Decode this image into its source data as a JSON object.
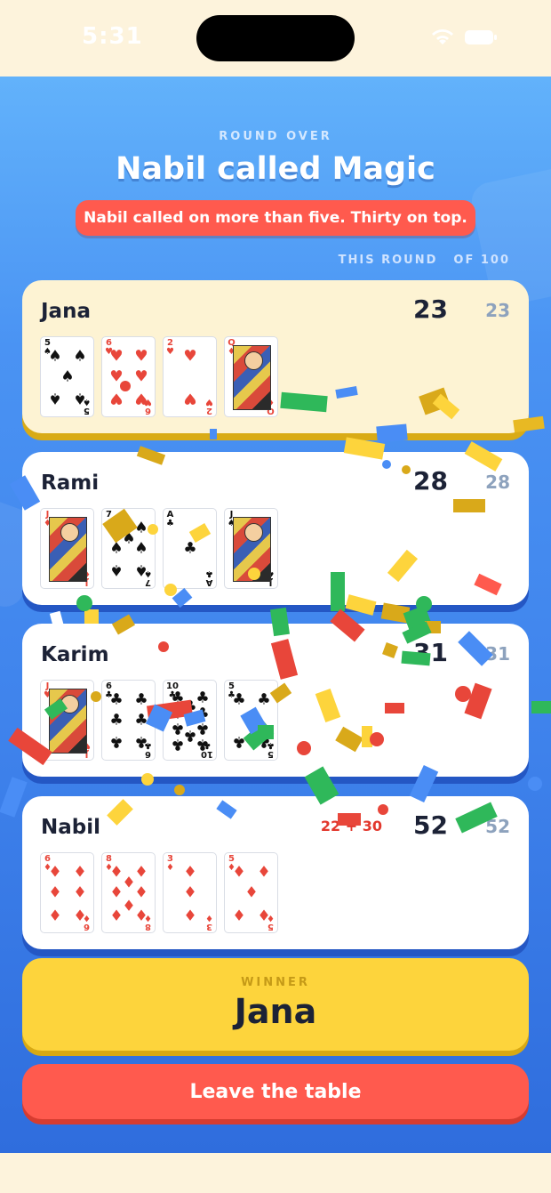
{
  "status_bar": {
    "time": "5:31"
  },
  "round": {
    "eyebrow": "ROUND OVER",
    "headline": "Nabil called Magic",
    "subtitle": "Nabil called on more than five. Thirty on top.",
    "col_round": "THIS ROUND",
    "col_total": "OF 100"
  },
  "players": [
    {
      "name": "Jana",
      "round_score": "23",
      "total": "23",
      "penalty": "",
      "cards": [
        {
          "rank": "5",
          "suit": "♠",
          "color": "black"
        },
        {
          "rank": "6",
          "suit": "♥",
          "color": "red"
        },
        {
          "rank": "2",
          "suit": "♥",
          "color": "red"
        },
        {
          "rank": "Q",
          "suit": "♦",
          "color": "red"
        }
      ]
    },
    {
      "name": "Rami",
      "round_score": "28",
      "total": "28",
      "penalty": "",
      "cards": [
        {
          "rank": "J",
          "suit": "♦",
          "color": "red"
        },
        {
          "rank": "7",
          "suit": "♠",
          "color": "black"
        },
        {
          "rank": "A",
          "suit": "♣",
          "color": "black"
        },
        {
          "rank": "J",
          "suit": "♠",
          "color": "black"
        }
      ]
    },
    {
      "name": "Karim",
      "round_score": "31",
      "total": "31",
      "penalty": "",
      "cards": [
        {
          "rank": "J",
          "suit": "♥",
          "color": "red"
        },
        {
          "rank": "6",
          "suit": "♣",
          "color": "black"
        },
        {
          "rank": "10",
          "suit": "♣",
          "color": "black"
        },
        {
          "rank": "5",
          "suit": "♣",
          "color": "black"
        }
      ]
    },
    {
      "name": "Nabil",
      "round_score": "52",
      "total": "52",
      "penalty": "22 + 30",
      "cards": [
        {
          "rank": "6",
          "suit": "♦",
          "color": "red"
        },
        {
          "rank": "8",
          "suit": "♦",
          "color": "red"
        },
        {
          "rank": "3",
          "suit": "♦",
          "color": "red"
        },
        {
          "rank": "5",
          "suit": "♦",
          "color": "red"
        }
      ]
    }
  ],
  "winner": {
    "label": "WINNER",
    "name": "Jana"
  },
  "actions": {
    "leave_label": "Leave the table"
  },
  "colors": {
    "accent_red": "#ff5a4e",
    "gold": "#fdd43c",
    "blue": "#3f83ec"
  }
}
